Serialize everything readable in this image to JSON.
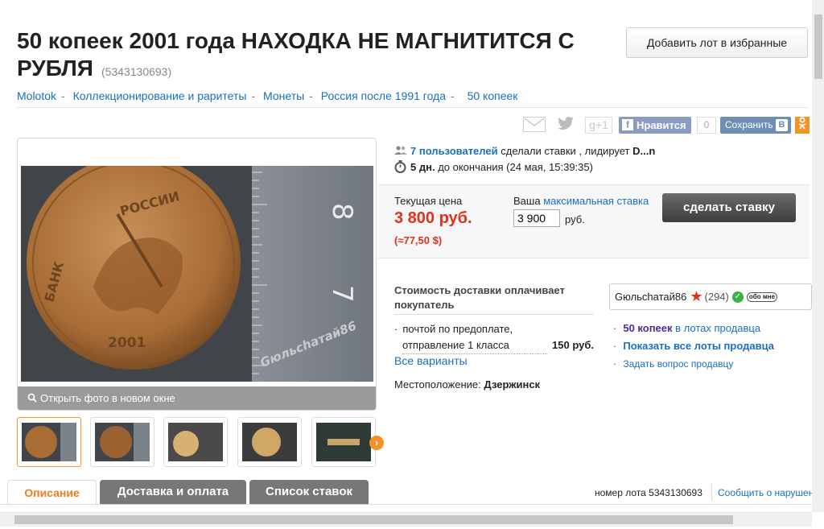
{
  "lot": {
    "title": "50 копеек 2001 года НАХОДКА НЕ МАГНИТИТСЯ С РУБЛЯ",
    "id": "(5343130693)",
    "favorite_label": "Добавить лот в избранные"
  },
  "breadcrumbs": [
    "Molotok",
    "Коллекционирование и раритеты",
    "Монеты",
    "Россия после 1991 года",
    "50 копеек"
  ],
  "share": {
    "gplus": "g+1",
    "fb_like": "Нравится",
    "fb_count": "0",
    "vk_save": "Сохранить",
    "vk_badge": "B"
  },
  "gallery": {
    "open_photo": "Открыть фото в новом окне",
    "coin_text": [
      "БАНК",
      "РОССИИ",
      "2001"
    ],
    "watermark": "Gюльchатай86",
    "ruler_marks": [
      "8",
      "7"
    ]
  },
  "auction": {
    "bidders_link": "7 пользователей",
    "bidders_text": "сделали ставки , лидирует",
    "leader": "D...n",
    "days_left": "5 дн.",
    "until_text": "до окончания (24 мая, 15:39:35)"
  },
  "price": {
    "current_label": "Текущая цена",
    "current_value": "3 800 руб.",
    "usd": "(≈77,50 $)",
    "your_label": "Ваша",
    "max_bid_link": "максимальная ставка",
    "bid_value": "3 900",
    "currency": "руб.",
    "bid_button": "сделать ставку"
  },
  "delivery": {
    "heading": "Стоимость доставки оплачивает покупатель",
    "item_line1": "почтой по предоплате,",
    "item_line2": "отправление 1 класса",
    "item_price": "150 руб.",
    "all_variants": "Все варианты",
    "location_label": "Местоположение:",
    "location_value": "Дзержинск"
  },
  "seller": {
    "name": "Gюльchатай86",
    "rating": "(294)",
    "about_badge": "обо мне",
    "link1_bold": "50 копеек",
    "link1_rest": "в лотах продавца",
    "link2": "Показать все лоты продавца",
    "link3": "Задать вопрос продавцу"
  },
  "tabs": [
    "Описание",
    "Доставка и оплата",
    "Список ставок"
  ],
  "footer": {
    "lot_number": "номер лота 5343130693",
    "report": "Сообщить о нарушении"
  },
  "colors": {
    "price_red": "#e0301e",
    "link_blue": "#1a6fbf",
    "accent_orange": "#f39325"
  }
}
